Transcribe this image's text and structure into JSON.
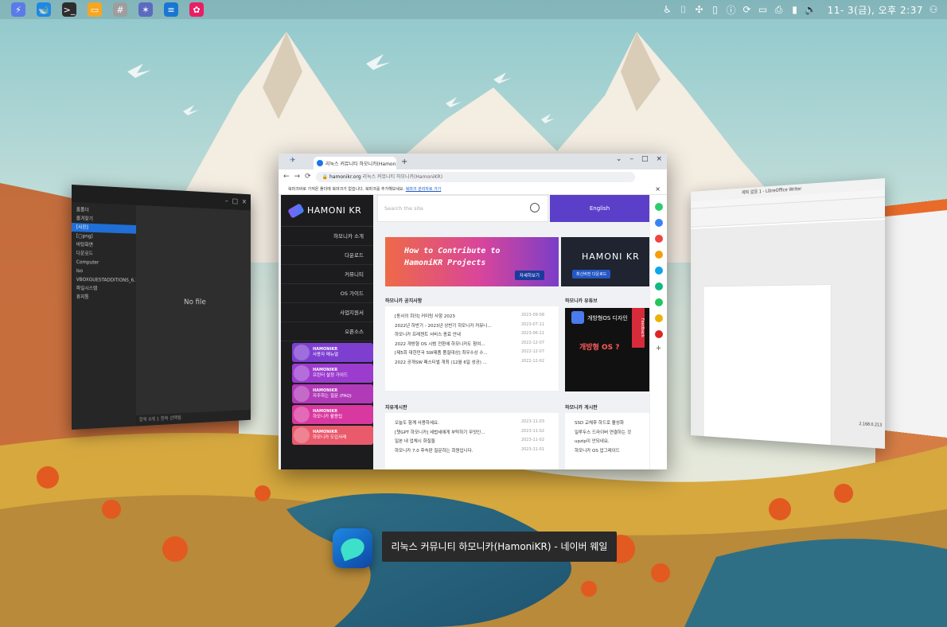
{
  "panel": {
    "apps": [
      {
        "name": "hamonikr-menu",
        "color": "#5b7be8",
        "glyph": "⚡"
      },
      {
        "name": "naver-whale",
        "color": "#1e88e5",
        "glyph": "🐋"
      },
      {
        "name": "terminal",
        "color": "#2d2d2d",
        "glyph": ">_"
      },
      {
        "name": "files",
        "color": "#f5a623",
        "glyph": "▭"
      },
      {
        "name": "calculator",
        "color": "#9e9e9e",
        "glyph": "#"
      },
      {
        "name": "network-tool",
        "color": "#5c6bc0",
        "glyph": "✶"
      },
      {
        "name": "office",
        "color": "#1976d2",
        "glyph": "≡"
      },
      {
        "name": "photos",
        "color": "#e91e63",
        "glyph": "✿"
      }
    ],
    "clock": "11- 3(금), 오후 2:37"
  },
  "file_window": {
    "sidebar": [
      "홈폴더",
      "즐겨찾기",
      "[사진]",
      "[▢png]",
      "바탕화면",
      "다운로드",
      "Computer",
      "Iso",
      "VBOXGUESTADDITIONS_6.1.38",
      "파일시스템",
      "휴지통"
    ],
    "no_file": "No file",
    "status": "항목 0개    1 항목 선택됨"
  },
  "writer": {
    "title": "제목 없음 1 - LibreOffice Writer",
    "ip": "2.168.0.213"
  },
  "browser": {
    "tab_title": "리눅스 커뮤니티 하모니카(HamoniKR)",
    "url_domain": "hamonikr.org",
    "url_rest": " 리눅스 커뮤니티 하모니카(HamoniKR)",
    "infobar": "북마크바로 가져온 폴더에 북마크가 없습니다. 북마크를 추가해보세요.",
    "infobar_link": "북마크 관리자로 가기",
    "site": {
      "logo": "HAMONI KR",
      "nav": [
        "하모니카 소개",
        "다운로드",
        "커뮤니티",
        "OS 가이드",
        "사업지원서",
        "오픈소스"
      ],
      "cards": [
        {
          "title": "HAMONIKR",
          "sub": "사용자 매뉴얼",
          "color": "#7e3fd1"
        },
        {
          "title": "HAMONIKR",
          "sub": "프린터 설정 가이드",
          "color": "#9c3ccf"
        },
        {
          "title": "HAMONIKR",
          "sub": "자주하는 질문 (FAQ)",
          "color": "#b13ab8"
        },
        {
          "title": "HAMONIKR",
          "sub": "하모니카 활용팁",
          "color": "#d8389f"
        },
        {
          "title": "HAMONIKR",
          "sub": "하모니카 도입사례",
          "color": "#e85a6c"
        }
      ],
      "search_placeholder": "Search the site",
      "english": "English",
      "banner1": [
        "How to Contribute to",
        "HamoniKR Projects"
      ],
      "banner1_btn": "자세히보기",
      "banner2": "HAMONI KR",
      "banner2_btn": "최신버전 다운로드",
      "notice_title": "하모니카 공지사항",
      "notices": [
        {
          "t": "[동사의 회의] 커미팅 사항 2023",
          "d": "2023-09-08"
        },
        {
          "t": "2022년 하반기 - 2023년 상반기 하모니카 커뮤니...",
          "d": "2023-07-11"
        },
        {
          "t": "하모니카 프레젠트 서비스 종료 안내",
          "d": "2023-06-11"
        },
        {
          "t": "2022 개방형 OS 시범 전환에 하모니카도 참여...",
          "d": "2022-12-07"
        },
        {
          "t": "[제5회 대한민국 SW제품 품질대상] 최우수상 수...",
          "d": "2022-12-07"
        },
        {
          "t": "2022 공개SW 페스티벌 개최 (12월 6일 성공) ...",
          "d": "2022-12-02"
        }
      ],
      "youtube_title": "하모니카 유튜브",
      "youtube_t1": "개방형OS 디자인",
      "youtube_t2": "개방형 OS ?",
      "feedback": "Feedback",
      "free_title": "자유게시판",
      "free_posts": [
        {
          "t": "오늘도 함께 사용하세요.",
          "d": "2023-11-03"
        },
        {
          "t": "[챗GPT 하모니카] 세법세에게 부탁하기 무엇인...",
          "d": "2023-11-02"
        },
        {
          "t": "일본 내 업체시 화질들",
          "d": "2023-11-02"
        },
        {
          "t": "하모니카 7.0 후속판 질문하는 회원입니다.",
          "d": "2023-11-01"
        }
      ],
      "qna_title": "하모니카 게시판",
      "qna_posts": [
        {
          "t": "SSD 교체후 하드로 활성화"
        },
        {
          "t": "일루두스 드라이버 연결하는 것"
        },
        {
          "t": "upzip이 안되네요."
        },
        {
          "t": "하모니카 OS 업그레이드"
        }
      ]
    }
  },
  "dock": {
    "tooltip": "리눅스 커뮤니티 하모니카(HamoniKR) - 네이버 웨일"
  }
}
